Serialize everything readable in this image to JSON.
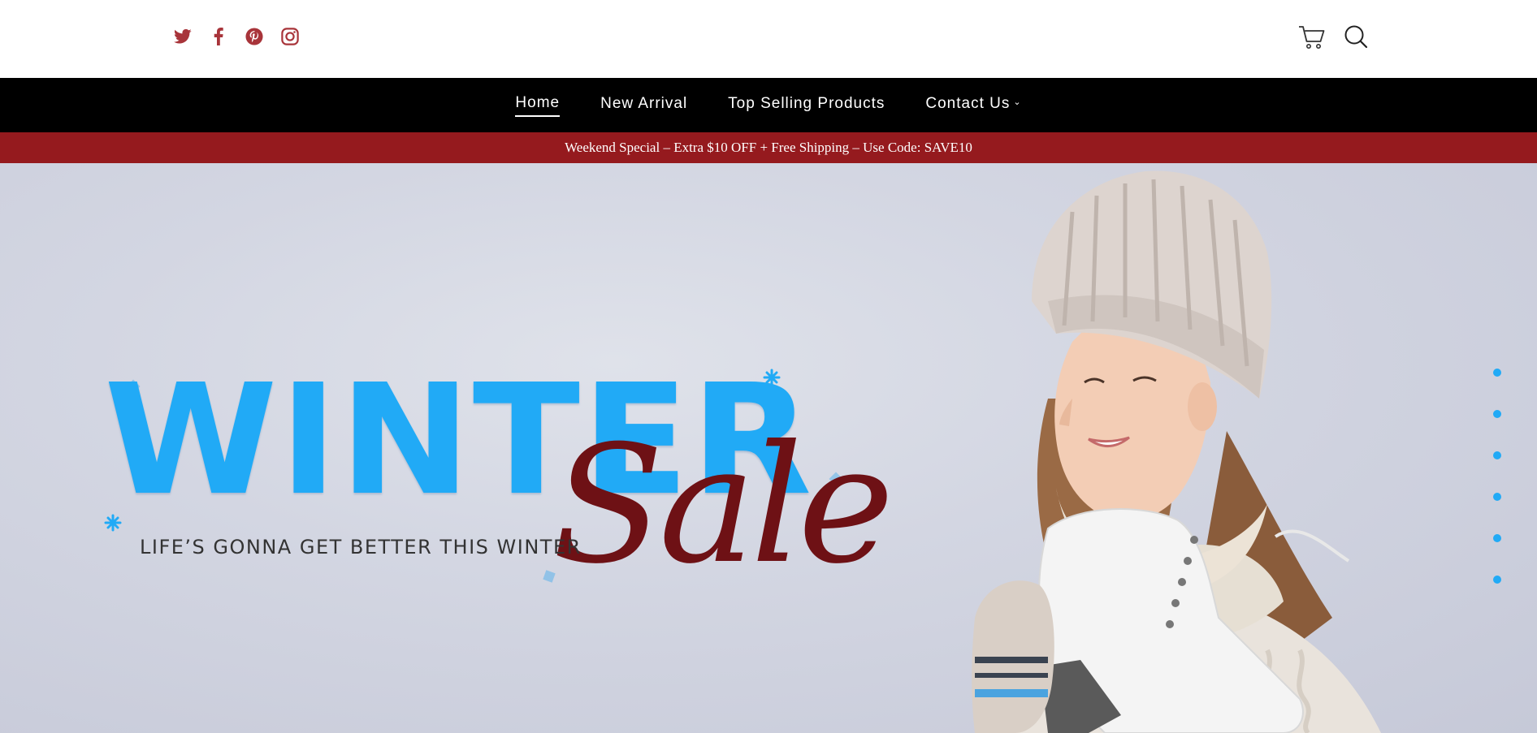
{
  "header": {
    "social": [
      {
        "name": "twitter-icon",
        "color": "#a8343a"
      },
      {
        "name": "facebook-icon",
        "color": "#a8343a"
      },
      {
        "name": "pinterest-icon",
        "color": "#a8343a"
      },
      {
        "name": "instagram-icon",
        "color": "#a8343a"
      }
    ],
    "actions": [
      {
        "name": "cart-icon"
      },
      {
        "name": "search-icon"
      }
    ]
  },
  "nav": {
    "items": [
      {
        "label": "Home",
        "active": true
      },
      {
        "label": "New Arrival"
      },
      {
        "label": "Top Selling Products"
      },
      {
        "label": "Contact Us",
        "has_dropdown": true
      }
    ]
  },
  "promo": {
    "text": "Weekend Special – Extra $10 OFF + Free Shipping – Use Code: SAVE10"
  },
  "hero": {
    "headline": "WINTER",
    "script": "Sale",
    "tagline": "LIFE’S GONNA GET BETTER THIS WINTER",
    "slide_count": 6,
    "accent_color": "#21aaf6",
    "script_color": "#6e1115"
  },
  "colors": {
    "promo_bg": "#951a1e",
    "nav_bg": "#000000",
    "social_icon": "#a8343a"
  }
}
